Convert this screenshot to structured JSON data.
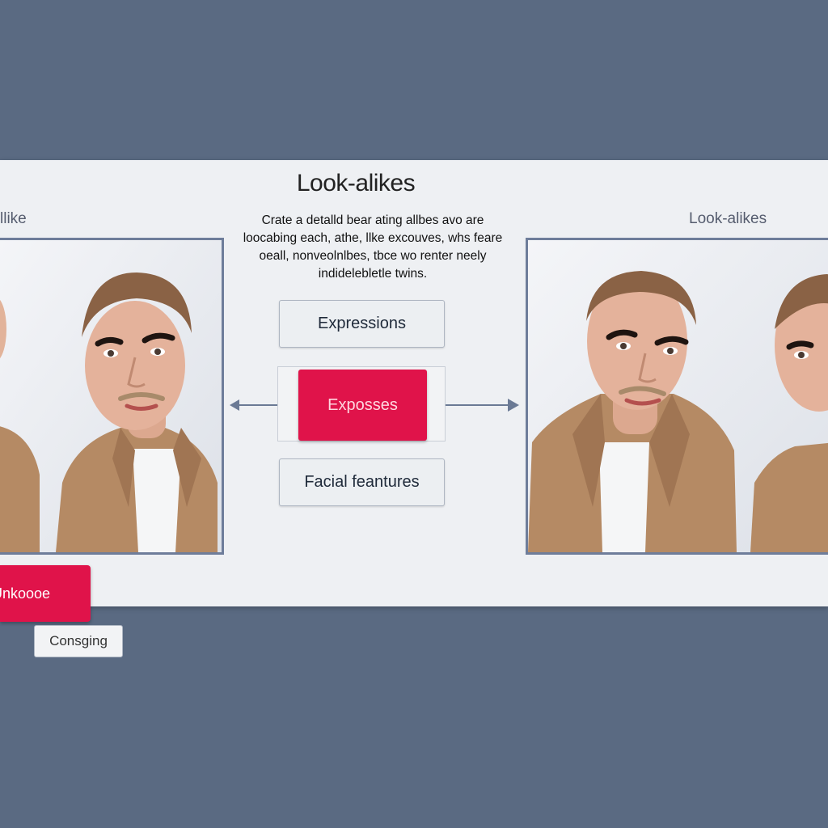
{
  "header": {
    "title": "Look-alikes"
  },
  "side_labels": {
    "left": "llike",
    "right": "Look-alikes"
  },
  "description": "Crate a detalld bear ating allbes avo are loocabing each, athe, llke excouves, whs feare oeall, nonveolnlbes, tbce wo renter neely indidelebletle twins.",
  "buttons": {
    "expressions": "Expressions",
    "primary": "Exposses",
    "facial_features": "Facial feantures",
    "bottom_red": "Unkoooe",
    "bottom_gray": "Consging"
  },
  "icons": [
    "double-arrow-left-icon",
    "double-arrow-right-icon"
  ],
  "colors": {
    "background": "#5a6a82",
    "panel": "#eef0f3",
    "accent": "#e0134a",
    "frame": "#6e7d9a"
  }
}
